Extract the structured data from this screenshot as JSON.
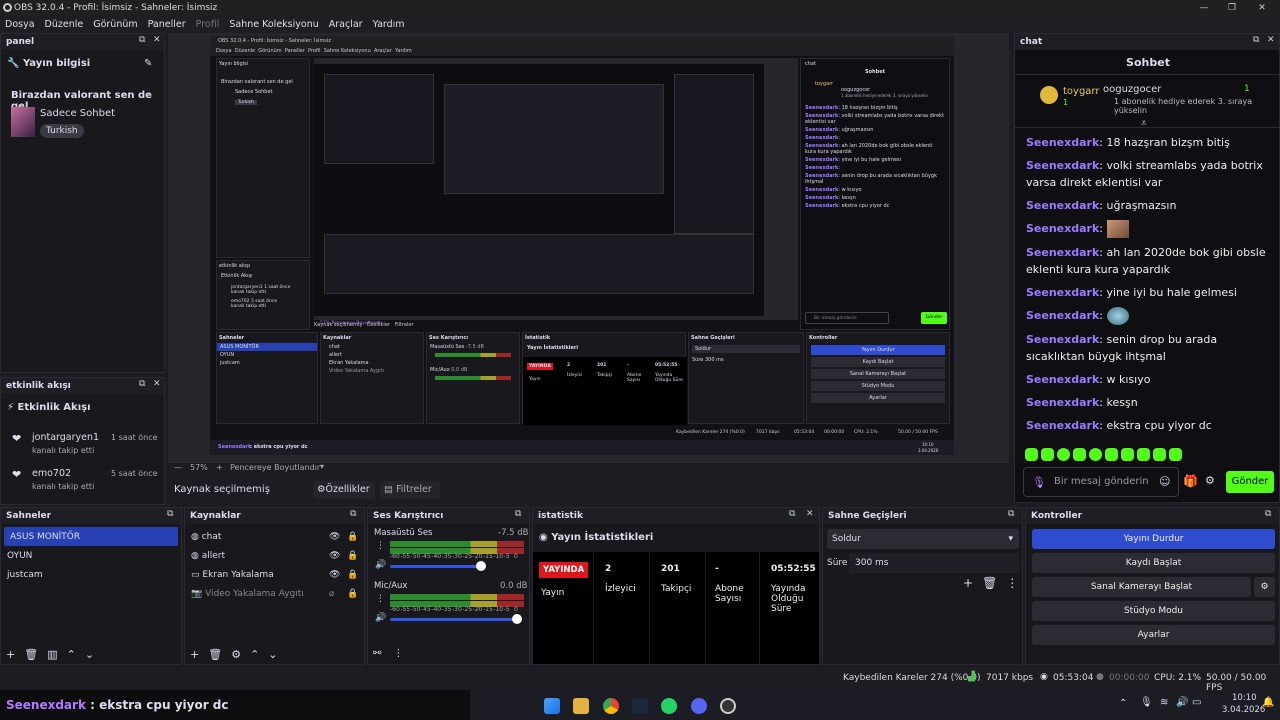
{
  "window": {
    "title": "OBS 32.0.4 - Profil: İsimsiz - Sahneler: İsimsiz"
  },
  "menu": [
    "Dosya",
    "Düzenle",
    "Görünüm",
    "Paneller",
    "Profil",
    "Sahne Koleksiyonu",
    "Araçlar",
    "Yardım"
  ],
  "panel": {
    "title": "panel",
    "section": "Yayın bilgisi",
    "stream_title": "Birazdan valorant sen de gel",
    "category": "Sadece Sohbet",
    "tag": "Turkish"
  },
  "activity": {
    "title": "etkinlik akışı",
    "section": "Etkinlik Akışı",
    "items": [
      {
        "user": "jontargaryen1",
        "time": "1 saat önce",
        "action": "kanalı takip etti"
      },
      {
        "user": "emo702",
        "time": "5 saat önce",
        "action": "kanalı takip etti"
      }
    ]
  },
  "chat": {
    "title": "chat",
    "header": "Sohbet",
    "pinned_user": "toygarr",
    "pinned_count": "1",
    "gifter": "ooguzgocer",
    "gift_count": "1",
    "gift_text": "1 abonelik hediye ederek 3. sıraya yükselin",
    "messages": [
      {
        "user": "Seenexdark",
        "text": ": 18 hazşran bizşm bitiş"
      },
      {
        "user": "Seenexdark",
        "text": ": volki streamlabs yada botrix varsa direkt eklentisi var"
      },
      {
        "user": "Seenexdark",
        "text": ": uğraşmazsın"
      },
      {
        "user": "Seenexdark",
        "text": ":",
        "emote": true
      },
      {
        "user": "Seenexdark",
        "text": ": ah lan 2020de bok gibi obsle eklenti kura kura yapardık"
      },
      {
        "user": "Seenexdark",
        "text": ": yine iyi bu hale gelmesi"
      },
      {
        "user": "Seenexdark",
        "text": ":",
        "emote": true
      },
      {
        "user": "Seenexdark",
        "text": ": senin drop bu arada sıcaklıktan büygk ihtşmal"
      },
      {
        "user": "Seenexdark",
        "text": ": w kısıyo"
      },
      {
        "user": "Seenexdark",
        "text": ": kesşn"
      },
      {
        "user": "Seenexdark",
        "text": ": ekstra cpu yiyor dc"
      }
    ],
    "input_placeholder": "Bir mesaj gönderin",
    "send_label": "Gönder"
  },
  "preview": {
    "zoom": "57%",
    "fit_label": "Pencereye Boyutlandır",
    "source_status": "Kaynak seçilmemiş",
    "properties": "Özellikler",
    "filters": "Filtreler"
  },
  "scenes": {
    "title": "Sahneler",
    "items": [
      "ASUS MONİTÖR",
      "OYUN",
      "justcam"
    ]
  },
  "sources": {
    "title": "Kaynaklar",
    "items": [
      "chat",
      "allert",
      "Ekran Yakalama",
      "Video Yakalama Aygıtı"
    ]
  },
  "mixer": {
    "title": "Ses Karıştırıcı",
    "channels": [
      {
        "name": "Masaüstü Ses",
        "db": "-7.5 dB",
        "level": 0.78,
        "volume": 0.68
      },
      {
        "name": "Mic/Aux",
        "db": "0.0 dB",
        "level": 0.55,
        "volume": 0.95
      }
    ],
    "ticks": [
      "-60",
      "-55",
      "-50",
      "-45",
      "-40",
      "-35",
      "-30",
      "-25",
      "-20",
      "-15",
      "-10",
      "-5",
      "0"
    ]
  },
  "stats": {
    "title": "istatistik",
    "header": "Yayın İstatistikleri",
    "live": "YAYINDA",
    "live_label": "Yayın",
    "viewers": "2",
    "viewers_label": "İzleyici",
    "followers": "201",
    "followers_label": "Takipçi",
    "subs": "-",
    "subs_label": "Abone Sayısı",
    "uptime": "05:52:55",
    "uptime_label": "Yayında Olduğu Süre"
  },
  "transitions": {
    "title": "Sahne Geçişleri",
    "selected": "Soldur",
    "duration_label": "Süre",
    "duration": "300 ms"
  },
  "controls": {
    "title": "Kontroller",
    "stop": "Yayını Durdur",
    "record": "Kaydı Başlat",
    "vcam": "Sanal Kamerayı Başlat",
    "studio": "Stüdyo Modu",
    "settings": "Ayarlar"
  },
  "status": {
    "frames": "Kaybedilen Kareler 274 (%0.0)",
    "bitrate": "7017 kbps",
    "stream_time": "05:53:04",
    "rec_time": "00:00:00",
    "cpu": "CPU: 2.1%",
    "fps": "50.00 / 50.00 FPS"
  },
  "overlay": {
    "user": "Seenexdark",
    "text": " : ekstra cpu yiyor dc"
  },
  "clock": {
    "time": "10:10",
    "date": "3.04.2026"
  },
  "nested_preview": {
    "window_title": "OBS 32.0.4 - Profil: İsimsiz - Sahneler: İsimsiz",
    "menu": [
      "Dosya",
      "Düzenle",
      "Görünüm",
      "Paneller",
      "Profil",
      "Sahne Koleksiyonu",
      "Araçlar",
      "Yardım"
    ],
    "panel_section": "Yayın bilgisi",
    "stream_title": "Birazdan valorant sen de gel",
    "category": "Sadece Sohbet",
    "tag": "Turkish",
    "activity_title": "etkinlik akışı",
    "activity_section": "Etkinlik Akışı",
    "activity_items": [
      {
        "user": "jontargaryen1",
        "time": "1 saat önce",
        "action": "kanalı takip etti"
      },
      {
        "user": "emo702",
        "time": "5 saat önce",
        "action": "kanalı takip etti"
      }
    ],
    "chat_title": "chat",
    "chat_header": "Sohbet",
    "pinned_user": "toygarr",
    "gifter": "ooguzgocer",
    "gift_text": "1 abonelik hediye ederek 3. sıraya yükselin",
    "messages": [
      ": 18 hazşran bizşm bitiş",
      ": volki streamlabs yada botrix varsa direkt eklentisi var",
      ": uğraşmazsın",
      ":",
      ": ah lan 2020de bok gibi obsle eklenti kura kura yapardık",
      ": yine iyi bu hale gelmesi",
      ":",
      ": senin drop bu arada sıcaklıktan büygk ihtşmal",
      ": w kısıyo",
      ": kesşn",
      ": ekstra cpu yiyor dc"
    ],
    "chat_user": "Seenexdark",
    "input_placeholder": "Bir mesaj gönderin",
    "send_label": "Gönder",
    "zoom": "57%",
    "fit_label": "Pencereye Boyutlandır",
    "source_status": "Kaynak seçilmemiş",
    "properties": "Özellikler",
    "filters": "Filtreler",
    "scenes_title": "Sahneler",
    "scenes": [
      "ASUS MONİTÖR",
      "OYUN",
      "justcam"
    ],
    "sources_title": "Kaynaklar",
    "sources": [
      "chat",
      "allert",
      "Ekran Yakalama",
      "Video Yakalama Aygıtı"
    ],
    "mixer_title": "Ses Karıştırıcı",
    "mixer_ch1": "Masaüstü Ses",
    "mixer_ch1_db": "-7.5 dB",
    "mixer_ch2": "Mic/Aux",
    "mixer_ch2_db": "0.0 dB",
    "stats_title": "İstatistik",
    "stats_header": "Yayın İstatistikleri",
    "live": "YAYINDA",
    "live_label": "Yayın",
    "viewers": "2",
    "viewers_label": "İzleyici",
    "followers": "201",
    "followers_label": "Takipçi",
    "subs": "-",
    "subs_label": "Abone Sayısı",
    "uptime": "05:52:55",
    "uptime_label": "Yayında Olduğu Süre",
    "transitions_title": "Sahne Geçişleri",
    "transition": "Soldur",
    "duration_label": "Süre",
    "duration": "300 ms",
    "controls_title": "Kontroller",
    "stop": "Yayını Durdur",
    "record": "Kaydı Başlat",
    "vcam": "Sanal Kamerayı Başlat",
    "studio": "Stüdyo Modu",
    "settings": "Ayarlar",
    "status_frames": "Kaybedilen Kareler 274 (%0.0)",
    "status_bitrate": "7017 kbps",
    "status_time": "05:53:04",
    "status_rec": "00:00:00",
    "status_cpu": "CPU: 2.1%",
    "status_fps": "50.00 / 50.00 FPS",
    "overlay_text": " : ekstra cpu yiyor dc",
    "clock_time": "10:10",
    "clock_date": "3.04.2026"
  },
  "colors": {
    "accent": "#2f4bd0",
    "live": "#e0161d",
    "chat_user": "#9b7bff",
    "send": "#53fc18"
  }
}
